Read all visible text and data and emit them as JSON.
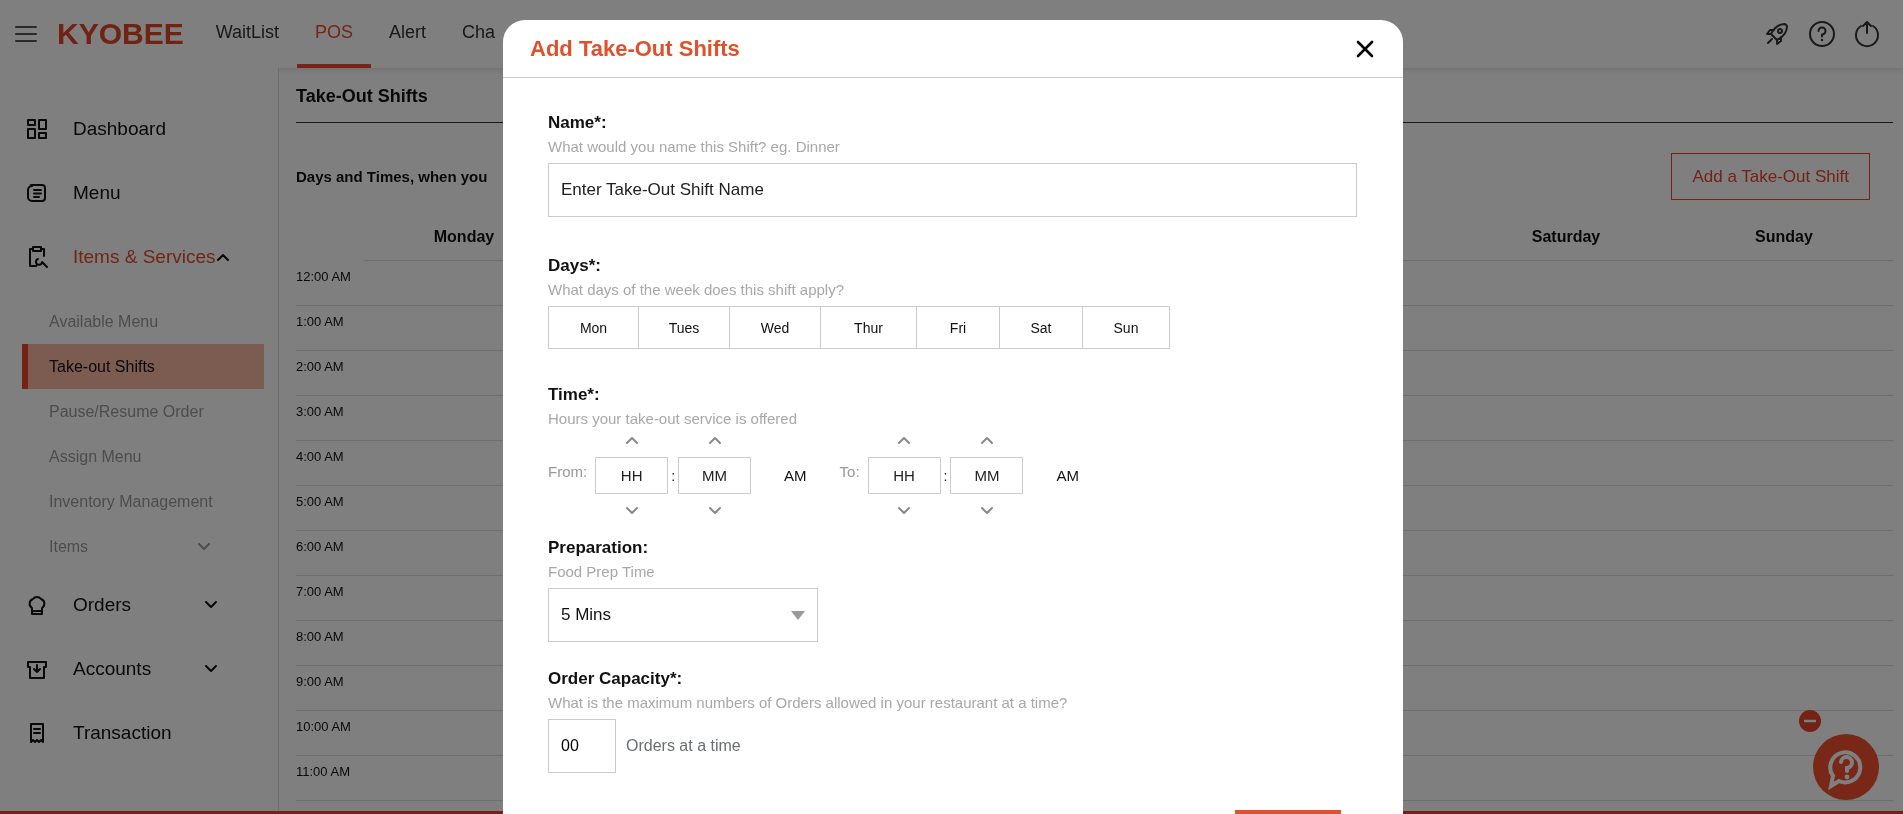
{
  "header": {
    "logo": "KYOBEE",
    "nav": [
      {
        "label": "WaitList",
        "selected": false
      },
      {
        "label": "POS",
        "selected": true
      },
      {
        "label": "Alert",
        "selected": false
      },
      {
        "label": "Cha",
        "selected": false
      }
    ]
  },
  "sidebar": {
    "items": [
      {
        "label": "Dashboard",
        "selected": false
      },
      {
        "label": "Menu",
        "selected": false
      },
      {
        "label": "Items & Services",
        "selected": true,
        "expanded": true,
        "children": [
          {
            "label": "Available Menu",
            "selected": false
          },
          {
            "label": "Take-out Shifts",
            "selected": true
          },
          {
            "label": "Pause/Resume Order",
            "selected": false
          },
          {
            "label": "Assign Menu",
            "selected": false
          },
          {
            "label": "Inventory Management",
            "selected": false
          },
          {
            "label": "Items",
            "selected": false,
            "expanded": false
          }
        ]
      },
      {
        "label": "Orders",
        "selected": false,
        "expanded": false
      },
      {
        "label": "Accounts",
        "selected": false,
        "expanded": false
      },
      {
        "label": "Transaction",
        "selected": false
      }
    ]
  },
  "page": {
    "title": "Take-Out Shifts",
    "subtitle": "Days and Times, when you",
    "add_button": "Add a Take-Out Shift",
    "schedule": {
      "columns": [
        "Monday",
        "Saturday",
        "Sunday"
      ],
      "times": [
        "12:00 AM",
        "1:00 AM",
        "2:00 AM",
        "3:00 AM",
        "4:00 AM",
        "5:00 AM",
        "6:00 AM",
        "7:00 AM",
        "8:00 AM",
        "9:00 AM",
        "10:00 AM",
        "11:00 AM"
      ]
    }
  },
  "modal": {
    "title": "Add Take-Out Shifts",
    "fields": [
      {
        "kind": "text",
        "label": "Name*:",
        "hint": "What would you name this Shift? eg. Dinner",
        "placeholder": "Enter Take-Out Shift Name"
      },
      {
        "kind": "days",
        "label": "Days*:",
        "hint": "What days of the week does this shift apply?",
        "options": [
          {
            "label": "Mon",
            "selected": false
          },
          {
            "label": "Tues",
            "selected": false
          },
          {
            "label": "Wed",
            "selected": false
          },
          {
            "label": "Thur",
            "selected": false
          },
          {
            "label": "Fri",
            "selected": false
          },
          {
            "label": "Sat",
            "selected": false
          },
          {
            "label": "Sun",
            "selected": false
          }
        ]
      },
      {
        "kind": "time",
        "label": "Time*:",
        "hint": "Hours your take-out service is offered",
        "ranges": [
          {
            "label": "From:",
            "hour": "HH",
            "separator": ":",
            "minute": "MM",
            "meridiem": "AM"
          },
          {
            "label": "To:",
            "hour": "HH",
            "separator": ":",
            "minute": "MM",
            "meridiem": "AM"
          }
        ]
      },
      {
        "kind": "select",
        "label": "Preparation:",
        "hint": "Food Prep Time",
        "value": "5 Mins"
      },
      {
        "kind": "capacity",
        "label": "Order Capacity*:",
        "hint": "What is the maximum numbers of Orders allowed in your restaurant at a time?",
        "value": "00",
        "suffix": "Orders at a time"
      }
    ],
    "actions": [
      {
        "kind": "submit"
      }
    ]
  }
}
